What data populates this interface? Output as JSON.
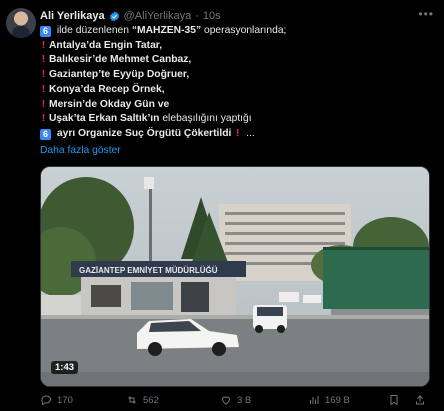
{
  "author": {
    "name": "Ali Yerlikaya",
    "handle": "@AliYerlikaya",
    "separator": "·",
    "time": "10s"
  },
  "tweet": {
    "lines": [
      {
        "icon": "6",
        "parts": [
          {
            "t": " ilde düzenlenen ",
            "b": false
          },
          {
            "t": "“MAHZEN-35”",
            "b": true
          },
          {
            "t": " operasyonlarında;",
            "b": false
          }
        ]
      },
      {
        "icon": "!",
        "parts": [
          {
            "t": "Antalya’da Engin Tatar,",
            "b": true
          }
        ]
      },
      {
        "icon": "!",
        "parts": [
          {
            "t": "Balıkesir’de Mehmet Canbaz,",
            "b": true
          }
        ]
      },
      {
        "icon": "!",
        "parts": [
          {
            "t": "Gaziantep’te Eyyüp Doğruer,",
            "b": true
          }
        ]
      },
      {
        "icon": "!",
        "parts": [
          {
            "t": "Konya’da Recep Örnek,",
            "b": true
          }
        ]
      },
      {
        "icon": "!",
        "parts": [
          {
            "t": "Mersin’de Okday Gün ve",
            "b": true
          }
        ]
      },
      {
        "icon": "!",
        "parts": [
          {
            "t": "Uşak’ta Erkan Saltık’ın",
            "b": true
          },
          {
            "t": " elebaşılığını yaptığı",
            "b": false
          }
        ]
      },
      {
        "icon": "6",
        "parts": [
          {
            "t": " ayrı Organize Suç Örgütü Çökertildi",
            "b": true
          },
          {
            "t": " ",
            "b": false
          },
          {
            "t": "!",
            "b": "excl"
          },
          {
            "t": " ...",
            "b": false
          }
        ]
      }
    ],
    "show_more": "Daha fazla göster"
  },
  "media": {
    "building_sign": "GAZİANTEP EMNİYET MÜDÜRLÜĞÜ",
    "duration": "1:43"
  },
  "actions": {
    "replies": "170",
    "reposts": "562",
    "likes": "3 B",
    "views": "169 B"
  },
  "colors": {
    "background": "#000000",
    "accent": "#1d9bf0",
    "muted": "#71767b",
    "emoji_red": "#e0245e",
    "keycap_blue": "#3a86ff"
  }
}
